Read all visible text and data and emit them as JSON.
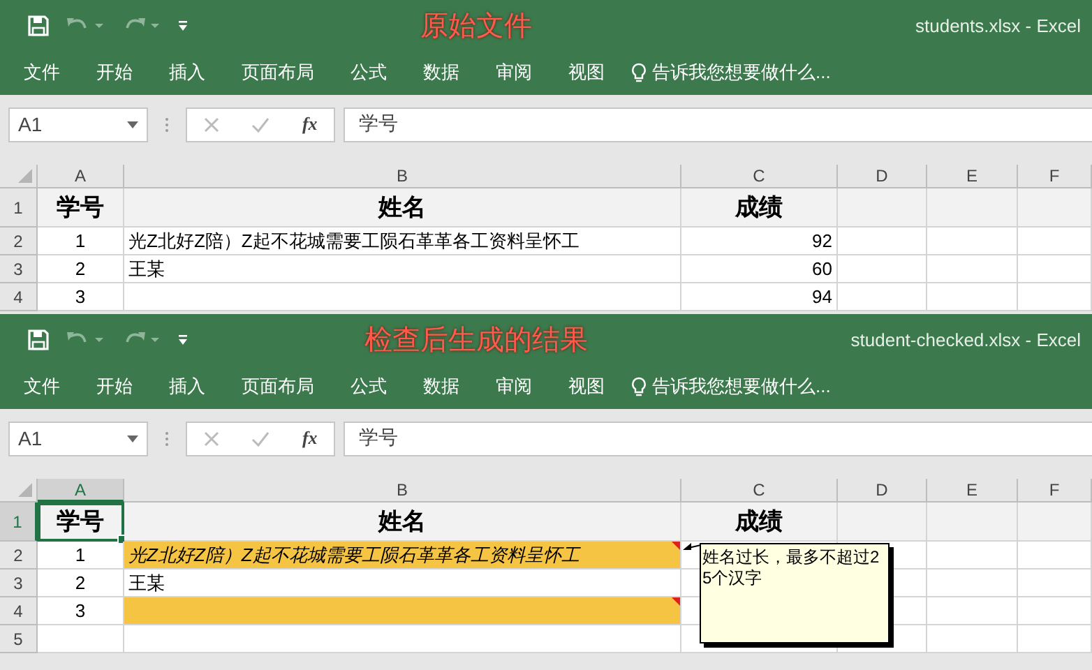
{
  "panels": [
    {
      "overlay_title": "原始文件",
      "filename": "students.xlsx - Excel",
      "ribbon_tabs": [
        "文件",
        "开始",
        "插入",
        "页面布局",
        "公式",
        "数据",
        "审阅",
        "视图"
      ],
      "tell_me": "告诉我您想要做什么...",
      "name_box": "A1",
      "fx": "fx",
      "formula": "学号",
      "columns": [
        "A",
        "B",
        "C",
        "D",
        "E",
        "F"
      ],
      "rows": [
        {
          "number": "1",
          "cells": [
            {
              "text": "学号",
              "selected": false,
              "highlighted": false,
              "italic": false,
              "comment": false
            },
            {
              "text": "姓名",
              "selected": false,
              "highlighted": false,
              "italic": false,
              "comment": false
            },
            {
              "text": "成绩",
              "selected": false,
              "highlighted": false,
              "italic": false,
              "comment": false
            },
            {
              "selected": false,
              "highlighted": false,
              "comment": false
            },
            {
              "selected": false,
              "highlighted": false,
              "comment": false
            },
            {
              "selected": false,
              "highlighted": false,
              "comment": false
            }
          ]
        },
        {
          "number": "2",
          "cells": [
            {
              "text": "1",
              "selected": false,
              "highlighted": false,
              "italic": false,
              "comment": false
            },
            {
              "text": "光Z北好Z陪）Z起不花城需要工陨石革革各工资料呈怀工",
              "selected": false,
              "highlighted": false,
              "italic": false,
              "comment": false
            },
            {
              "text": "92",
              "selected": false,
              "highlighted": false,
              "italic": false,
              "comment": false
            },
            {
              "selected": false,
              "highlighted": false,
              "comment": false
            },
            {
              "selected": false,
              "highlighted": false,
              "comment": false
            },
            {
              "selected": false,
              "highlighted": false,
              "comment": false
            }
          ]
        },
        {
          "number": "3",
          "cells": [
            {
              "text": "2",
              "selected": false,
              "highlighted": false,
              "italic": false,
              "comment": false
            },
            {
              "text": "王某",
              "selected": false,
              "highlighted": false,
              "italic": false,
              "comment": false
            },
            {
              "text": "60",
              "selected": false,
              "highlighted": false,
              "italic": false,
              "comment": false
            },
            {
              "selected": false,
              "highlighted": false,
              "comment": false
            },
            {
              "selected": false,
              "highlighted": false,
              "comment": false
            },
            {
              "selected": false,
              "highlighted": false,
              "comment": false
            }
          ]
        },
        {
          "number": "4",
          "cells": [
            {
              "text": "3",
              "selected": false,
              "highlighted": false,
              "italic": false,
              "comment": false
            },
            {
              "selected": false,
              "highlighted": false,
              "comment": false
            },
            {
              "text": "94",
              "selected": false,
              "highlighted": false,
              "italic": false,
              "comment": false
            },
            {
              "selected": false,
              "highlighted": false,
              "comment": false
            },
            {
              "selected": false,
              "highlighted": false,
              "comment": false
            },
            {
              "selected": false,
              "highlighted": false,
              "comment": false
            }
          ]
        }
      ]
    },
    {
      "overlay_title": "检查后生成的结果",
      "filename": "student-checked.xlsx - Excel",
      "ribbon_tabs": [
        "文件",
        "开始",
        "插入",
        "页面布局",
        "公式",
        "数据",
        "审阅",
        "视图"
      ],
      "tell_me": "告诉我您想要做什么...",
      "name_box": "A1",
      "fx": "fx",
      "formula": "学号",
      "columns": [
        "A",
        "B",
        "C",
        "D",
        "E",
        "F"
      ],
      "rows": [
        {
          "number": "1",
          "cells": [
            {
              "text": "学号",
              "selected": true,
              "highlighted": false,
              "italic": false,
              "comment": false
            },
            {
              "text": "姓名",
              "selected": false,
              "highlighted": false,
              "italic": false,
              "comment": false
            },
            {
              "text": "成绩",
              "selected": false,
              "highlighted": false,
              "italic": false,
              "comment": false
            },
            {
              "selected": false,
              "highlighted": false,
              "comment": false
            },
            {
              "selected": false,
              "highlighted": false,
              "comment": false
            },
            {
              "selected": false,
              "highlighted": false,
              "comment": false
            }
          ]
        },
        {
          "number": "2",
          "cells": [
            {
              "text": "1",
              "selected": false,
              "highlighted": false,
              "italic": false,
              "comment": false
            },
            {
              "text": "光Z北好Z陪）Z起不花城需要工陨石革革各工资料呈怀工",
              "selected": false,
              "highlighted": true,
              "italic": true,
              "comment": true
            },
            {
              "selected": false,
              "highlighted": false
            },
            {
              "selected": false,
              "highlighted": false,
              "comment": false
            },
            {
              "selected": false,
              "highlighted": false,
              "comment": false
            },
            {
              "selected": false,
              "highlighted": false,
              "comment": false
            }
          ]
        },
        {
          "number": "3",
          "cells": [
            {
              "text": "2",
              "selected": false,
              "highlighted": false,
              "italic": false,
              "comment": false
            },
            {
              "text": "王某",
              "selected": false,
              "highlighted": false,
              "italic": false,
              "comment": false
            },
            {
              "selected": false,
              "highlighted": false
            },
            {
              "selected": false,
              "highlighted": false,
              "comment": false
            },
            {
              "selected": false,
              "highlighted": false,
              "comment": false
            },
            {
              "selected": false,
              "highlighted": false,
              "comment": false
            }
          ]
        },
        {
          "number": "4",
          "cells": [
            {
              "text": "3",
              "selected": false,
              "highlighted": false,
              "italic": false,
              "comment": false
            },
            {
              "selected": false,
              "highlighted": true,
              "comment": true
            },
            {
              "selected": false,
              "highlighted": false
            },
            {
              "selected": false,
              "highlighted": false,
              "comment": false
            },
            {
              "selected": false,
              "highlighted": false,
              "comment": false
            },
            {
              "selected": false,
              "highlighted": false,
              "comment": false
            }
          ]
        },
        {
          "number": "5",
          "cells": [
            {
              "selected": false,
              "highlighted": false,
              "comment": false
            },
            {
              "selected": false,
              "highlighted": false,
              "comment": false
            },
            {
              "selected": false,
              "highlighted": false
            },
            {
              "selected": false,
              "highlighted": false,
              "comment": false
            },
            {
              "selected": false,
              "highlighted": false,
              "comment": false
            },
            {
              "selected": false,
              "highlighted": false,
              "comment": false
            }
          ]
        }
      ],
      "note": {
        "text": "姓名过长，最多不超过25个汉字"
      }
    }
  ]
}
